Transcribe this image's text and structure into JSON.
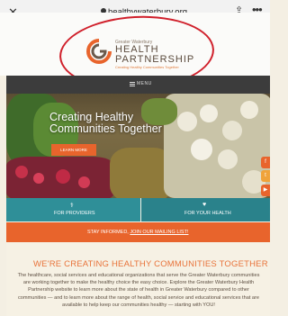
{
  "browser": {
    "close_icon": "✕",
    "back_icon": "←",
    "url": "healthywaterbury.org",
    "share_icon": "⇪",
    "more_icon": "•••"
  },
  "logo": {
    "small": "Greater Waterbury",
    "line1": "HEALTH",
    "line2": "PARTNERSHIP",
    "tagline": "Creating Healthy Communities Together"
  },
  "menu": {
    "label": "MENU"
  },
  "hero": {
    "title_line1": "Creating Healthy",
    "title_line2": "Communities Together",
    "button": "LEARN MORE"
  },
  "tabs": {
    "left_label": "FOR PROVIDERS",
    "left_icon": "stethoscope-icon",
    "right_label": "FOR YOUR HEALTH",
    "right_icon": "heart-icon"
  },
  "mailing": {
    "prefix": "STAY INFORMED,",
    "link": "JOIN OUR MAILING LIST!"
  },
  "section": {
    "heading": "WE'RE CREATING HEALTHY COMMUNITIES TOGETHER",
    "paragraph": "The healthcare, social services and educational organizations that serve the Greater Waterbury communities are working together to make the healthy choice the easy choice. Explore the Greater Waterbury Health Partnership website to learn more about the state of health in Greater Waterbury compared to other communities — and to learn more about the range of health, social service and educational services that are available to help keep our communities healthy — starting with YOU!"
  },
  "colors": {
    "accent_orange": "#e8642c",
    "teal": "#2f8f98",
    "annotation_red": "#d0202b"
  },
  "social": [
    {
      "name": "facebook-icon",
      "color": "#e8642c",
      "glyph": "f"
    },
    {
      "name": "twitter-icon",
      "color": "#f0a33a",
      "glyph": "t"
    },
    {
      "name": "youtube-icon",
      "color": "#e8642c",
      "glyph": "▶"
    },
    {
      "name": "instagram-icon",
      "color": "#f0a33a",
      "glyph": "◎"
    }
  ]
}
